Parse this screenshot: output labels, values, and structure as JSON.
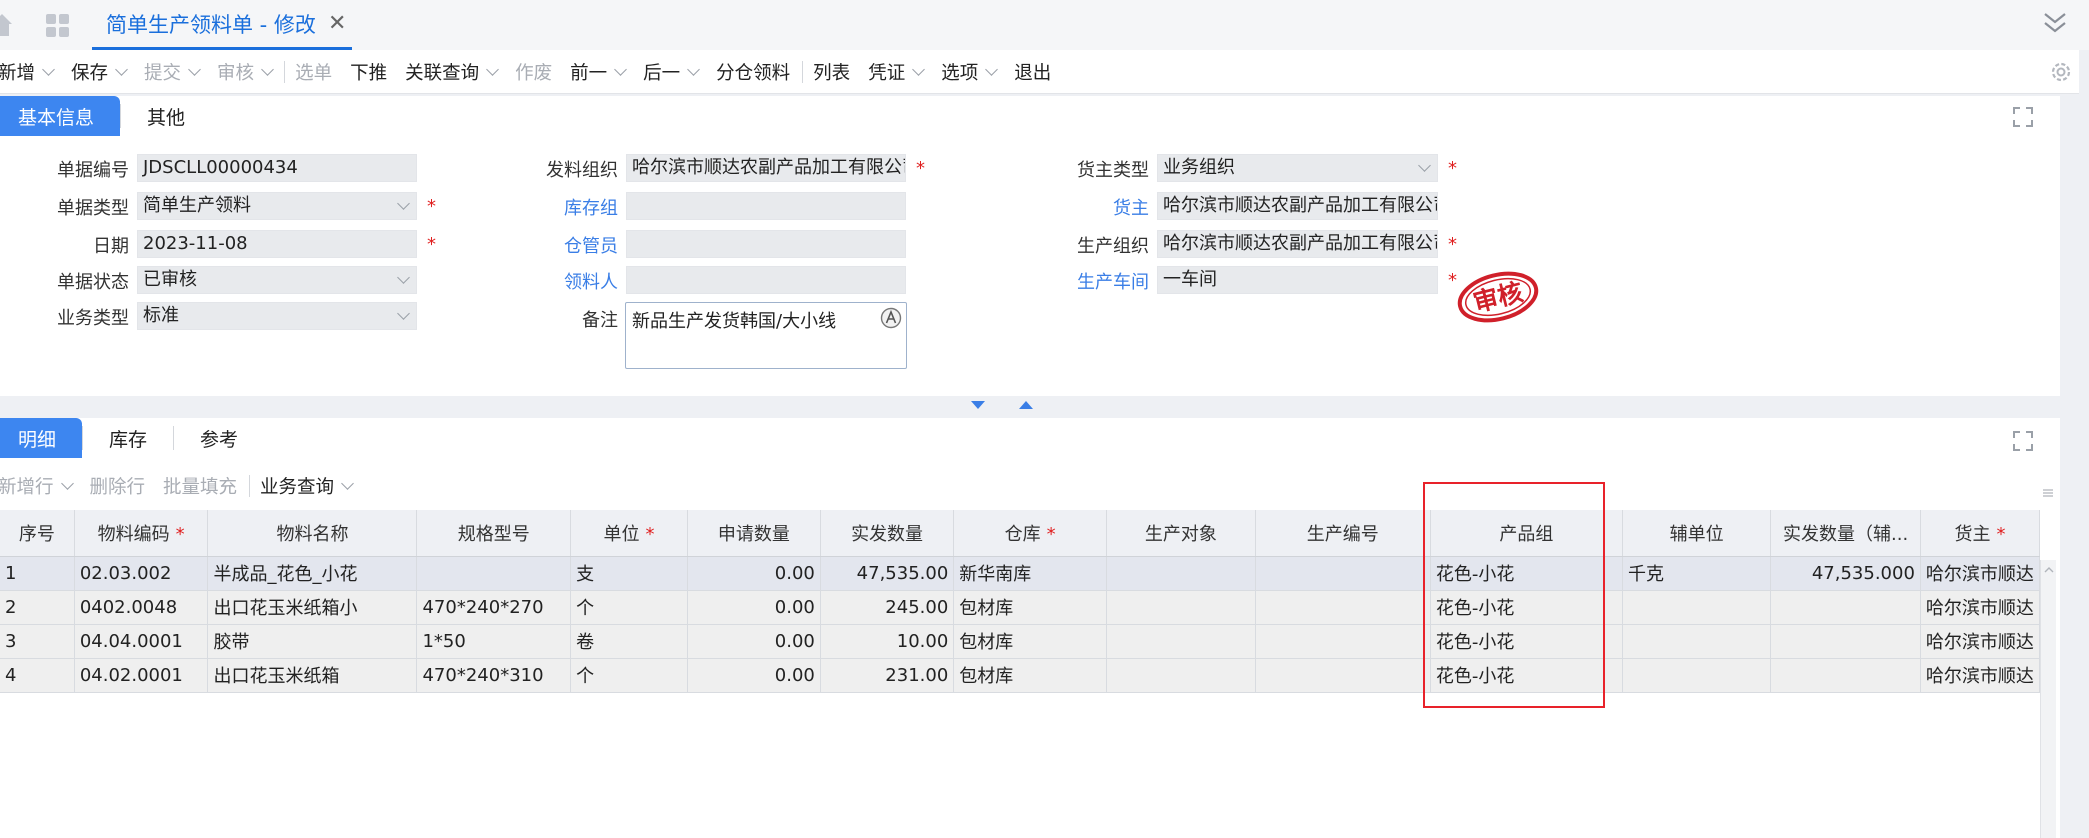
{
  "tab": {
    "title": "简单生产领料单 - 修改",
    "close": "✕"
  },
  "toolbar": [
    {
      "label": "新增",
      "caret": true,
      "disabled": false
    },
    {
      "label": "保存",
      "caret": true,
      "disabled": false
    },
    {
      "label": "提交",
      "caret": true,
      "disabled": true
    },
    {
      "label": "审核",
      "caret": true,
      "disabled": true
    },
    {
      "sep": true
    },
    {
      "label": "选单",
      "caret": false,
      "disabled": true
    },
    {
      "label": "下推",
      "caret": false,
      "disabled": false
    },
    {
      "label": "关联查询",
      "caret": true,
      "disabled": false
    },
    {
      "label": "作废",
      "caret": false,
      "disabled": true
    },
    {
      "label": "前一",
      "caret": true,
      "disabled": false
    },
    {
      "label": "后一",
      "caret": true,
      "disabled": false
    },
    {
      "label": "分仓领料",
      "caret": false,
      "disabled": false
    },
    {
      "sep": true
    },
    {
      "label": "列表",
      "caret": false,
      "disabled": false
    },
    {
      "label": "凭证",
      "caret": true,
      "disabled": false
    },
    {
      "label": "选项",
      "caret": true,
      "disabled": false
    },
    {
      "label": "退出",
      "caret": false,
      "disabled": false
    }
  ],
  "header_tabs": [
    "基本信息",
    "其他"
  ],
  "form": {
    "bill_no_label": "单据编号",
    "bill_no": "JDSCLL00000434",
    "bill_type_label": "单据类型",
    "bill_type": "简单生产领料",
    "date_label": "日期",
    "date": "2023-11-08",
    "status_label": "单据状态",
    "status": "已审核",
    "biz_type_label": "业务类型",
    "biz_type": "标准",
    "issue_org_label": "发料组织",
    "issue_org": "哈尔滨市顺达农副产品加工有限公司",
    "stock_group_label": "库存组",
    "stock_group": "",
    "keeper_label": "仓管员",
    "keeper": "",
    "picker_label": "领料人",
    "picker": "",
    "remark_label": "备注",
    "remark": "新品生产发货韩国/大小线",
    "owner_type_label": "货主类型",
    "owner_type": "业务组织",
    "owner_label": "货主",
    "owner": "哈尔滨市顺达农副产品加工有限公司",
    "prod_org_label": "生产组织",
    "prod_org": "哈尔滨市顺达农副产品加工有限公司",
    "workshop_label": "生产车间",
    "workshop": "一车间",
    "required": "*"
  },
  "stamp_text": "审核",
  "detail_tabs": [
    "明细",
    "库存",
    "参考"
  ],
  "detail_toolbar": [
    {
      "label": "新增行",
      "caret": true,
      "disabled": true
    },
    {
      "label": "删除行",
      "caret": false,
      "disabled": true
    },
    {
      "label": "批量填充",
      "caret": false,
      "disabled": true
    },
    {
      "sep": true
    },
    {
      "label": "业务查询",
      "caret": true,
      "disabled": false
    }
  ],
  "columns": [
    {
      "label": "序号",
      "req": false
    },
    {
      "label": "物料编码",
      "req": true
    },
    {
      "label": "物料名称",
      "req": false
    },
    {
      "label": "规格型号",
      "req": false
    },
    {
      "label": "单位",
      "req": true
    },
    {
      "label": "申请数量",
      "req": false
    },
    {
      "label": "实发数量",
      "req": false
    },
    {
      "label": "仓库",
      "req": true
    },
    {
      "label": "生产对象",
      "req": false
    },
    {
      "label": "生产编号",
      "req": false
    },
    {
      "label": "产品组",
      "req": false
    },
    {
      "label": "辅单位",
      "req": false
    },
    {
      "label": "实发数量（辅...",
      "req": false
    },
    {
      "label": "货主",
      "req": true
    }
  ],
  "rows": [
    [
      "1",
      "02.03.002",
      "半成品_花色_小花",
      "",
      "支",
      "0.00",
      "47,535.00",
      "新华南库",
      "",
      "",
      "花色-小花",
      "千克",
      "47,535.000",
      "哈尔滨市顺达"
    ],
    [
      "2",
      "0402.0048",
      "出口花玉米纸箱小",
      "470*240*270",
      "个",
      "0.00",
      "245.00",
      "包材库",
      "",
      "",
      "花色-小花",
      "",
      "",
      "哈尔滨市顺达"
    ],
    [
      "3",
      "04.04.0001",
      "胶带",
      "1*50",
      "卷",
      "0.00",
      "10.00",
      "包材库",
      "",
      "",
      "花色-小花",
      "",
      "",
      "哈尔滨市顺达"
    ],
    [
      "4",
      "04.02.0001",
      "出口花玉米纸箱",
      "470*240*310",
      "个",
      "0.00",
      "231.00",
      "包材库",
      "",
      "",
      "花色-小花",
      "",
      "",
      "哈尔滨市顺达"
    ]
  ],
  "colors": {
    "accent": "#3d86f0",
    "tab_text": "#1a6fdc",
    "required": "#e02020",
    "highlight": "#e8222a",
    "stamp": "#d0202a"
  }
}
